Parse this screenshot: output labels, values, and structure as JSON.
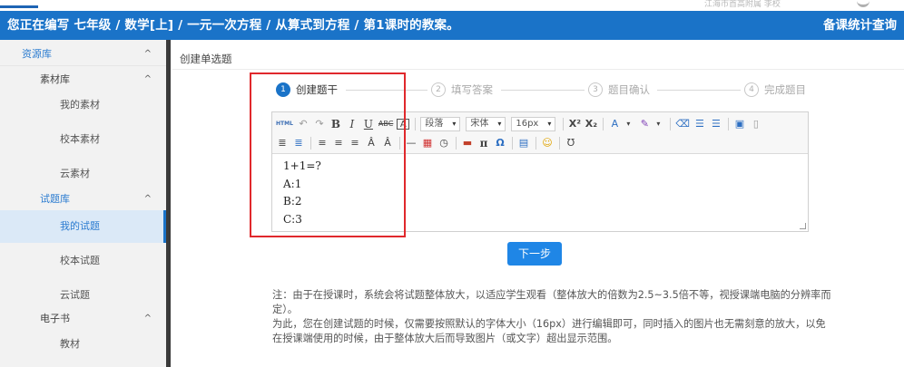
{
  "top": {
    "faded_text": "江海市首高附属 李校"
  },
  "header": {
    "title": "您正在编写 七年级 / 数学[上] / 一元一次方程 / 从算式到方程 / 第1课时的教案。",
    "stats_label": "备课统计查询"
  },
  "sidebar": {
    "resource_lib": "资源库",
    "material_lib": "素材库",
    "my_material": "我的素材",
    "school_material": "校本素材",
    "cloud_material": "云素材",
    "question_lib": "试题库",
    "my_questions": "我的试题",
    "school_questions": "校本试题",
    "cloud_questions": "云试题",
    "ebook": "电子书",
    "textbook": "教材",
    "chevron": "^"
  },
  "breadcrumb": "创建单选题",
  "steps": [
    {
      "num": "1",
      "label": "创建题干",
      "state": "active"
    },
    {
      "num": "2",
      "label": "填写答案",
      "state": "inactive"
    },
    {
      "num": "3",
      "label": "题目确认",
      "state": "inactive"
    },
    {
      "num": "4",
      "label": "完成题目",
      "state": "inactive"
    }
  ],
  "toolbar": {
    "html": "HTML",
    "paragraph": "段落",
    "font": "宋体",
    "size": "16px",
    "dropdown_arrow": "▾",
    "bold": "B",
    "italic": "I",
    "underline": "U",
    "strike": "ABC",
    "border_a": "A",
    "superscript": "X²",
    "subscript": "X₂",
    "font_color": "A",
    "pi": "π",
    "omega": "Ω",
    "upsilon": "Ʊ"
  },
  "editor": {
    "lines": [
      "1+1=?",
      "A:1",
      "B:2",
      "C:3"
    ]
  },
  "next_button": "下一步",
  "note": {
    "line1": "注：由于在授课时，系统会将试题整体放大，以适应学生观看（整体放大的倍数为2.5~3.5倍不等，视授课端电脑的分辨率而定）。",
    "line2": "为此，您在创建试题的时候，仅需要按照默认的字体大小（16px）进行编辑即可，同时插入的图片也无需刻意的放大，以免在授课端使用的时候，由于整体放大后而导致图片（或文字）超出显示范围。"
  },
  "colors": {
    "header_bg": "#1a73c8",
    "accent_blue": "#2a7bd0",
    "button_blue": "#1f86e6",
    "highlight_red": "#e0282c",
    "sidebar_bg": "#f2f2f2",
    "active_item_bg": "#dbe9f7"
  }
}
